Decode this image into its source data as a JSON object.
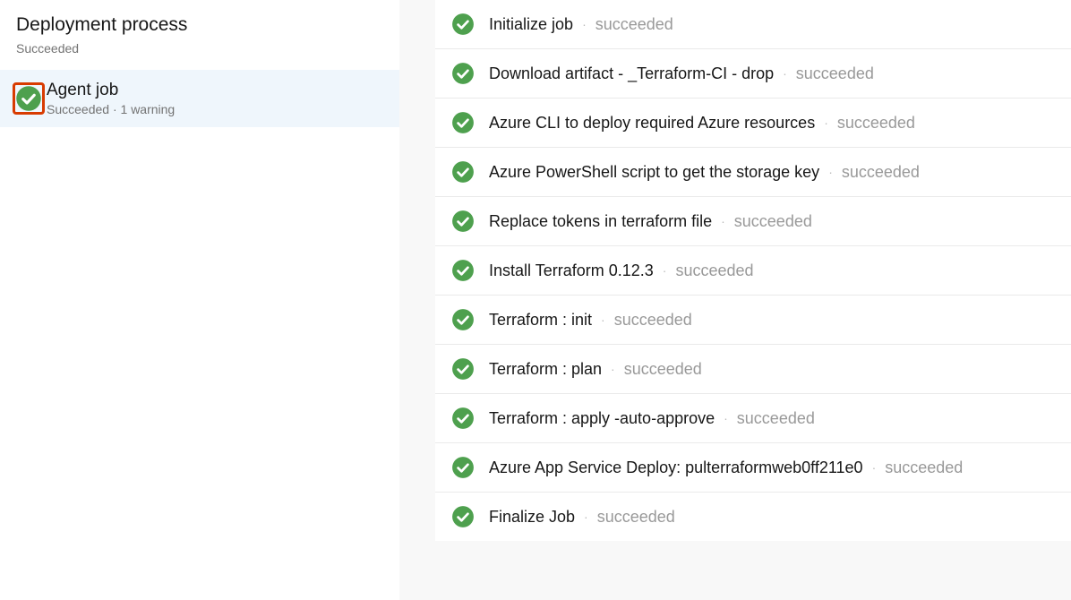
{
  "sidebar": {
    "title": "Deployment process",
    "status": "Succeeded",
    "item": {
      "title": "Agent job",
      "subStatus": "Succeeded",
      "subWarning": "1 warning"
    }
  },
  "tasks": [
    {
      "name": "Initialize job",
      "status": "succeeded"
    },
    {
      "name": "Download artifact - _Terraform-CI - drop",
      "status": "succeeded"
    },
    {
      "name": "Azure CLI to deploy required Azure resources",
      "status": "succeeded"
    },
    {
      "name": "Azure PowerShell script to get the storage key",
      "status": "succeeded"
    },
    {
      "name": "Replace tokens in terraform file",
      "status": "succeeded"
    },
    {
      "name": "Install Terraform 0.12.3",
      "status": "succeeded"
    },
    {
      "name": "Terraform : init",
      "status": "succeeded"
    },
    {
      "name": "Terraform : plan",
      "status": "succeeded"
    },
    {
      "name": "Terraform : apply -auto-approve",
      "status": "succeeded"
    },
    {
      "name": "Azure App Service Deploy: pulterraformweb0ff211e0",
      "status": "succeeded"
    },
    {
      "name": "Finalize Job",
      "status": "succeeded"
    }
  ]
}
